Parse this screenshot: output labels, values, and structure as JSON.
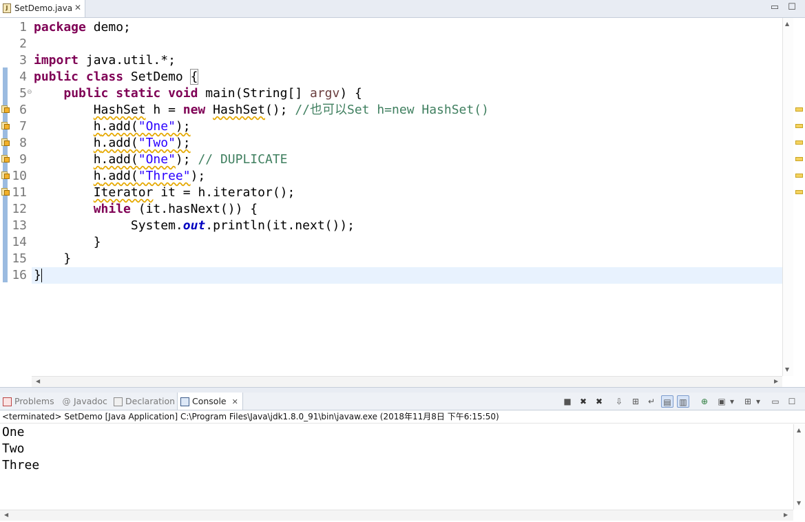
{
  "editor": {
    "tab_title": "SetDemo.java",
    "tab_close": "✕",
    "minimize": "▭",
    "maximize": "☐",
    "line_numbers": [
      "1",
      "2",
      "3",
      "4",
      "5",
      "6",
      "7",
      "8",
      "9",
      "10",
      "11",
      "12",
      "13",
      "14",
      "15",
      "16"
    ]
  },
  "code": {
    "l1_kw": "package",
    "l1_rest": " demo;",
    "l3_kw": "import",
    "l3_rest": " java.util.*;",
    "l4_kw": "public class",
    "l4_rest": " SetDemo ",
    "l4_brace": "{",
    "l5_kw": "public static void",
    "l5_mid": " main(String[] ",
    "l5_arg": "argv",
    "l5_end": ") {",
    "l6_type": "HashSet",
    "l6_mid": " h = ",
    "l6_kw": "new",
    "l6_sp": " ",
    "l6_type2": "HashSet",
    "l6_end": "(); ",
    "l6_cmt": "//也可以Set h=new HashSet()",
    "l7_obj": "h",
    "l7_call": ".add(",
    "l7_str": "\"One\"",
    "l7_end": ");",
    "l8_obj": "h",
    "l8_call": ".add(",
    "l8_str": "\"Two\"",
    "l8_end": ");",
    "l9_obj": "h",
    "l9_call": ".add(",
    "l9_str": "\"One\"",
    "l9_end": "); ",
    "l9_cmt": "// DUPLICATE",
    "l10_obj": "h",
    "l10_call": ".add(",
    "l10_str": "\"Three\"",
    "l10_end": ");",
    "l11_type": "Iterator",
    "l11_mid": " it = ",
    "l11_obj": "h",
    "l11_end": ".iterator();",
    "l12_kw": "while",
    "l12_rest": " (it.hasNext()) {",
    "l13_pre": "System.",
    "l13_fld": "out",
    "l13_rest": ".println(it.next());",
    "l14": "}",
    "l15": "}",
    "l16": "}"
  },
  "console": {
    "tabs": [
      "Problems",
      "Javadoc",
      "Declaration",
      "Console"
    ],
    "tab_close": "✕",
    "status": "<terminated> SetDemo [Java Application] C:\\Program Files\\Java\\jdk1.8.0_91\\bin\\javaw.exe (2018年11月8日 下午6:15:50)",
    "output": [
      "One",
      "Two",
      "Three"
    ],
    "toolbar": {
      "terminate": "■",
      "remove": "✖",
      "remove_all": "✖",
      "scroll_lock": "⇩",
      "pin": "⊞",
      "word_wrap": "↵",
      "show_out": "▤",
      "show_err": "▥",
      "open_console": "⊕",
      "display": "▣",
      "menu": "▾",
      "new": "⊞",
      "minimize": "▭",
      "maximize": "☐"
    }
  },
  "colors": {
    "keyword": "#7f0055",
    "string": "#2a00ff",
    "comment": "#3f7f5f",
    "field": "#0000c0",
    "warning": "#e5a800"
  }
}
